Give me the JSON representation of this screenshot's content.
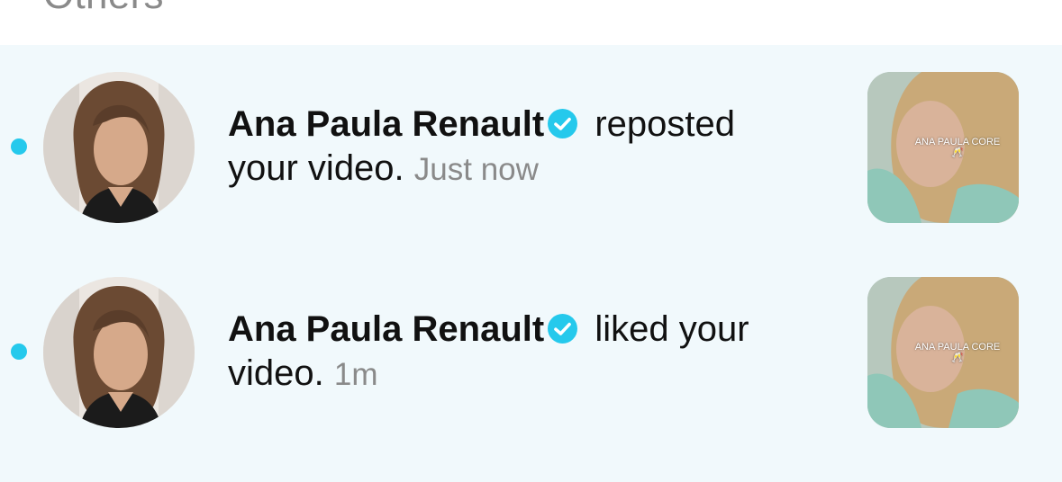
{
  "section": {
    "title": "Others"
  },
  "notifications": [
    {
      "name": "Ana Paula Renault",
      "action": "reposted your video.",
      "time": "Just now",
      "unread": true,
      "verified": true,
      "thumbnail_caption": "ANA PAULA CORE 🥂"
    },
    {
      "name": "Ana Paula Renault",
      "action": "liked your video.",
      "time": "1m",
      "unread": true,
      "verified": true,
      "thumbnail_caption": "ANA PAULA CORE 🥂"
    }
  ],
  "colors": {
    "accent": "#25c9ec",
    "row_background": "#f1f9fc",
    "muted_text": "#8a8a8a"
  }
}
